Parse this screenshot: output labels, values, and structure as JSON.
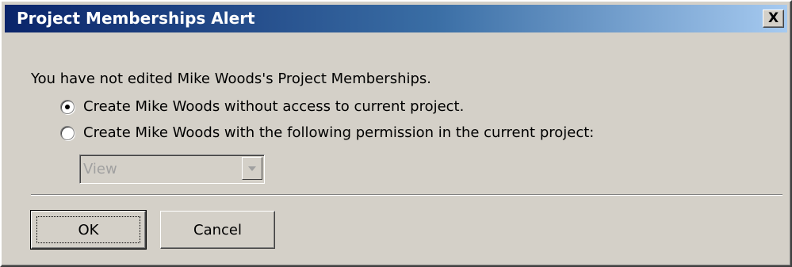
{
  "window": {
    "title": "Project Memberships Alert",
    "close_glyph": "X"
  },
  "message": "You have not edited Mike Woods's Project Memberships.",
  "options": [
    {
      "label": "Create Mike Woods without access to current project.",
      "checked": true
    },
    {
      "label": "Create Mike Woods with the following permission in the current project:",
      "checked": false
    }
  ],
  "permission_select": {
    "value": "View",
    "enabled": false
  },
  "buttons": {
    "ok": "OK",
    "cancel": "Cancel"
  },
  "colors": {
    "titlebar_start": "#0a246a",
    "titlebar_end": "#a6caf0",
    "face": "#d4d0c8"
  }
}
